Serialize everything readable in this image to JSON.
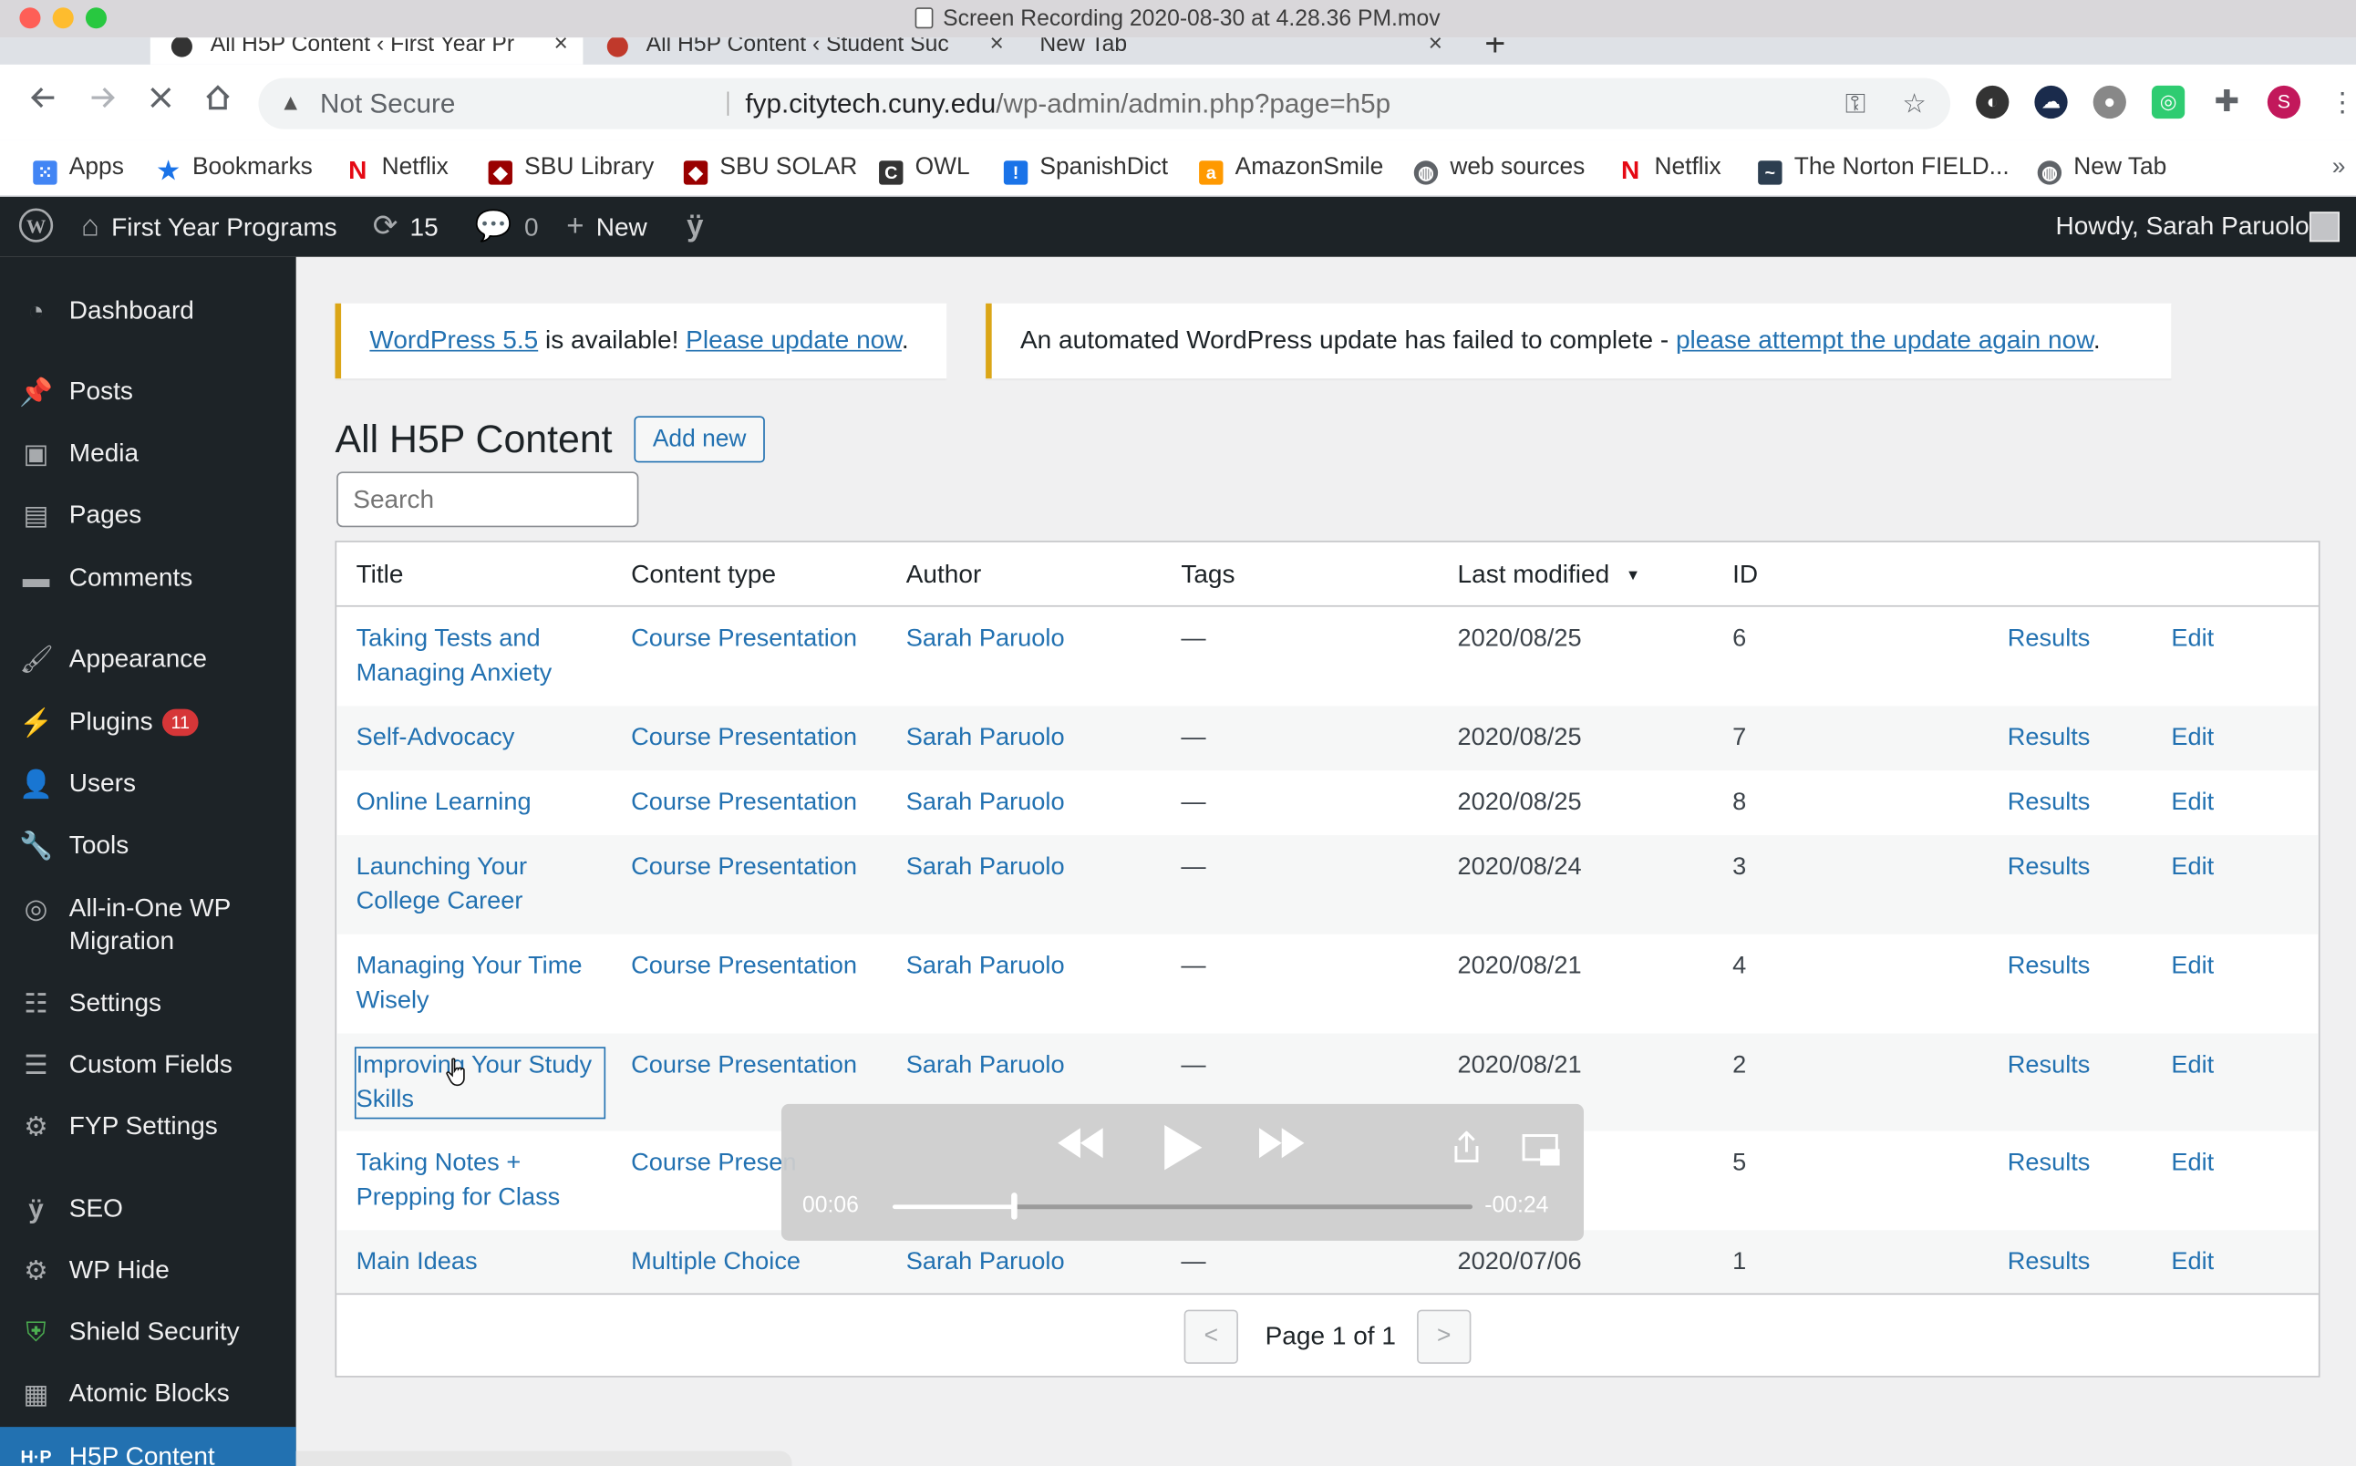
{
  "window": {
    "title": "Screen Recording 2020-08-30 at 4.28.36 PM.mov"
  },
  "browser": {
    "tabs": [
      {
        "label": "All H5P Content ‹ First Year Pr"
      },
      {
        "label": "All H5P Content ‹ Student Suc"
      },
      {
        "label": "New Tab"
      }
    ],
    "tab_close": "×",
    "new_tab": "+",
    "address": {
      "security": "Not Secure",
      "host": "fyp.citytech.cuny.edu",
      "path": "/wp-admin/admin.php?page=h5p"
    },
    "profile_initial": "S",
    "bookmarks": [
      {
        "label": "Apps",
        "icon": "apps-grid-icon"
      },
      {
        "label": "Bookmarks",
        "icon": "star-icon"
      },
      {
        "label": "Netflix",
        "icon": "netflix-icon"
      },
      {
        "label": "SBU Library",
        "icon": "sbu-shield-icon"
      },
      {
        "label": "SBU SOLAR",
        "icon": "sbu-shield-icon"
      },
      {
        "label": "OWL",
        "icon": "owl-icon"
      },
      {
        "label": "SpanishDict",
        "icon": "spanishdict-icon"
      },
      {
        "label": "AmazonSmile",
        "icon": "amazon-icon"
      },
      {
        "label": "web sources",
        "icon": "globe-icon"
      },
      {
        "label": "Netflix",
        "icon": "netflix-icon"
      },
      {
        "label": "The Norton FIELD...",
        "icon": "norton-icon"
      },
      {
        "label": "New Tab",
        "icon": "globe-icon"
      }
    ],
    "more_bookmarks": "»"
  },
  "adminbar": {
    "site_name": "First Year Programs",
    "updates_count": "15",
    "comments_count": "0",
    "new_label": "New",
    "greeting": "Howdy, Sarah Paruolo"
  },
  "sidebar": {
    "items": [
      {
        "label": "Dashboard"
      },
      {
        "label": "Posts"
      },
      {
        "label": "Media"
      },
      {
        "label": "Pages"
      },
      {
        "label": "Comments"
      },
      {
        "label": "Appearance"
      },
      {
        "label": "Plugins",
        "badge": "11"
      },
      {
        "label": "Users"
      },
      {
        "label": "Tools"
      },
      {
        "label": "All-in-One WP Migration"
      },
      {
        "label": "Settings"
      },
      {
        "label": "Custom Fields"
      },
      {
        "label": "FYP Settings"
      },
      {
        "label": "SEO"
      },
      {
        "label": "WP Hide"
      },
      {
        "label": "Shield Security"
      },
      {
        "label": "Atomic Blocks"
      },
      {
        "label": "H5P Content"
      }
    ]
  },
  "notices": {
    "update": {
      "link1": "WordPress 5.5",
      "text": " is available! ",
      "link2": "Please update now",
      "end": "."
    },
    "failed": {
      "text": "An automated WordPress update has failed to complete - ",
      "link": "please attempt the update again now",
      "end": "."
    }
  },
  "page": {
    "title": "All H5P Content",
    "add_new": "Add new",
    "search_placeholder": "Search"
  },
  "table": {
    "headers": {
      "title": "Title",
      "content_type": "Content type",
      "author": "Author",
      "tags": "Tags",
      "last_modified": "Last modified",
      "sort_indicator": "▼",
      "id": "ID"
    },
    "rows": [
      {
        "title": "Taking Tests and Managing Anxiety",
        "content_type": "Course Presentation",
        "author": "Sarah Paruolo",
        "tags": "—",
        "modified": "2020/08/25",
        "id": "6",
        "results": "Results",
        "edit": "Edit"
      },
      {
        "title": "Self-Advocacy",
        "content_type": "Course Presentation",
        "author": "Sarah Paruolo",
        "tags": "—",
        "modified": "2020/08/25",
        "id": "7",
        "results": "Results",
        "edit": "Edit"
      },
      {
        "title": "Online Learning",
        "content_type": "Course Presentation",
        "author": "Sarah Paruolo",
        "tags": "—",
        "modified": "2020/08/25",
        "id": "8",
        "results": "Results",
        "edit": "Edit"
      },
      {
        "title": "Launching Your College Career",
        "content_type": "Course Presentation",
        "author": "Sarah Paruolo",
        "tags": "—",
        "modified": "2020/08/24",
        "id": "3",
        "results": "Results",
        "edit": "Edit"
      },
      {
        "title": "Managing Your Time Wisely",
        "content_type": "Course Presentation",
        "author": "Sarah Paruolo",
        "tags": "—",
        "modified": "2020/08/21",
        "id": "4",
        "results": "Results",
        "edit": "Edit"
      },
      {
        "title": "Improving Your Study Skills",
        "content_type": "Course Presentation",
        "author": "Sarah Paruolo",
        "tags": "—",
        "modified": "2020/08/21",
        "id": "2",
        "results": "Results",
        "edit": "Edit"
      },
      {
        "title": "Taking Notes + Prepping for Class",
        "content_type": "Course Presen",
        "author": "",
        "tags": "",
        "modified": "",
        "id": "5",
        "results": "Results",
        "edit": "Edit"
      },
      {
        "title": "Main Ideas",
        "content_type": "Multiple Choice",
        "author": "Sarah Paruolo",
        "tags": "—",
        "modified": "2020/07/06",
        "id": "1",
        "results": "Results",
        "edit": "Edit"
      }
    ],
    "pagination": {
      "prev": "<",
      "label": "Page 1 of 1",
      "next": ">"
    }
  },
  "player": {
    "elapsed": "00:06",
    "remaining": "-00:24",
    "progress": 0.21
  }
}
